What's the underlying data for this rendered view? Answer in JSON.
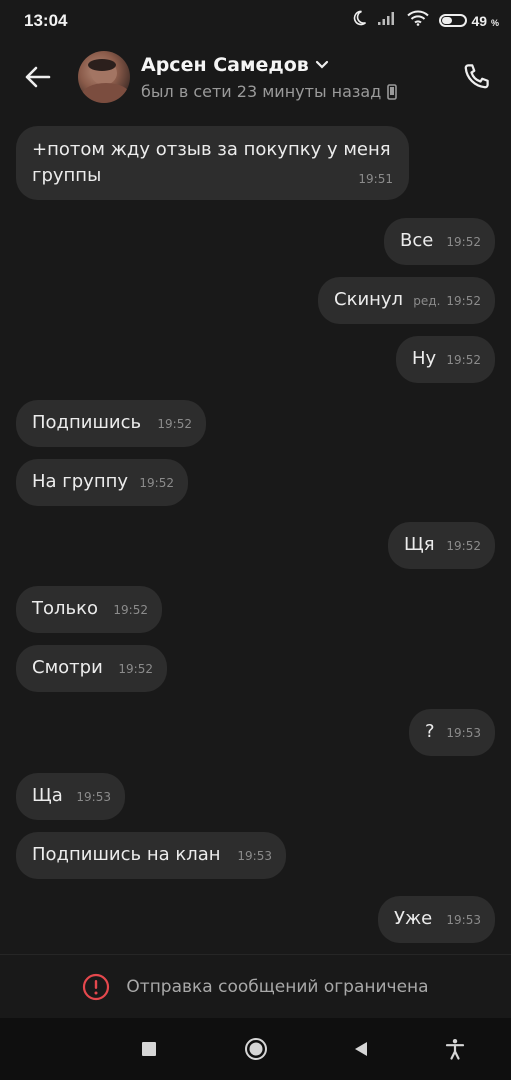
{
  "status_bar": {
    "time": "13:04",
    "battery_percent": "49",
    "battery_suffix": "%",
    "battery_level": 0.49,
    "icons": [
      "moon-icon",
      "signal-icon",
      "wifi-icon",
      "battery-icon"
    ]
  },
  "header": {
    "name": "Арсен Самедов",
    "status": "был в сети 23 минуты назад",
    "icons": [
      "back-arrow-icon",
      "chevron-down-icon",
      "phone-device-icon",
      "call-icon"
    ]
  },
  "messages": [
    {
      "side": "in",
      "lines": [
        "+потом жду отзыв за покупку у меня",
        "группы"
      ],
      "time": "19:51"
    },
    {
      "side": "out",
      "text": "Все",
      "time": "19:52"
    },
    {
      "side": "out",
      "text": "Скинул",
      "time": "19:52",
      "edited": "ред."
    },
    {
      "side": "out",
      "text": "Ну",
      "time": "19:52"
    },
    {
      "side": "in",
      "text": "Подпишись",
      "time": "19:52"
    },
    {
      "side": "in",
      "text": "На группу",
      "time": "19:52"
    },
    {
      "side": "out",
      "text": "Щя",
      "time": "19:52"
    },
    {
      "side": "in",
      "text": "Только",
      "time": "19:52"
    },
    {
      "side": "in",
      "text": "Смотри",
      "time": "19:52"
    },
    {
      "side": "out",
      "text": "?",
      "time": "19:53"
    },
    {
      "side": "in",
      "text": "Ща",
      "time": "19:53"
    },
    {
      "side": "in",
      "text": "Подпишись на клан",
      "time": "19:53"
    },
    {
      "side": "out",
      "text": "Уже",
      "time": "19:53"
    }
  ],
  "restriction": {
    "text": "Отправка сообщений ограничена",
    "icon": "alert-circle-icon",
    "icon_color": "#e5484d"
  },
  "nav_bar": {
    "icons": [
      "recents-square-icon",
      "home-circle-icon",
      "back-triangle-icon",
      "accessibility-icon"
    ]
  },
  "colors": {
    "background": "#191919",
    "bubble": "#2d2d2d",
    "text": "#ececec",
    "muted": "#8b8b8b"
  }
}
